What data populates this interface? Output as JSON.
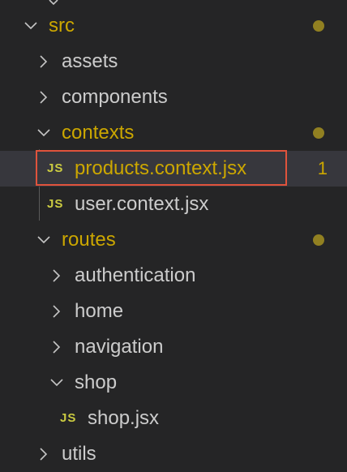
{
  "tree": {
    "src": {
      "label": "src",
      "expanded": true,
      "modified_dot": true
    },
    "assets": {
      "label": "assets",
      "expanded": false
    },
    "components": {
      "label": "components",
      "expanded": false
    },
    "contexts": {
      "label": "contexts",
      "expanded": true,
      "modified_dot": true
    },
    "products_context": {
      "label": "products.context.jsx",
      "icon_text": "JS",
      "badge": "1",
      "selected": true
    },
    "user_context": {
      "label": "user.context.jsx",
      "icon_text": "JS"
    },
    "routes": {
      "label": "routes",
      "expanded": true,
      "modified_dot": true
    },
    "authentication": {
      "label": "authentication",
      "expanded": false
    },
    "home": {
      "label": "home",
      "expanded": false
    },
    "navigation": {
      "label": "navigation",
      "expanded": false
    },
    "shop": {
      "label": "shop",
      "expanded": true
    },
    "shop_jsx": {
      "label": "shop.jsx",
      "icon_text": "JS"
    },
    "utils": {
      "label": "utils",
      "expanded": false
    }
  },
  "colors": {
    "background": "#252526",
    "text": "#cccccc",
    "modified_text": "#cca700",
    "modified_dot": "#918021",
    "js_icon": "#cbcb41",
    "selection": "#37373d",
    "highlight_border": "#e0533c"
  }
}
